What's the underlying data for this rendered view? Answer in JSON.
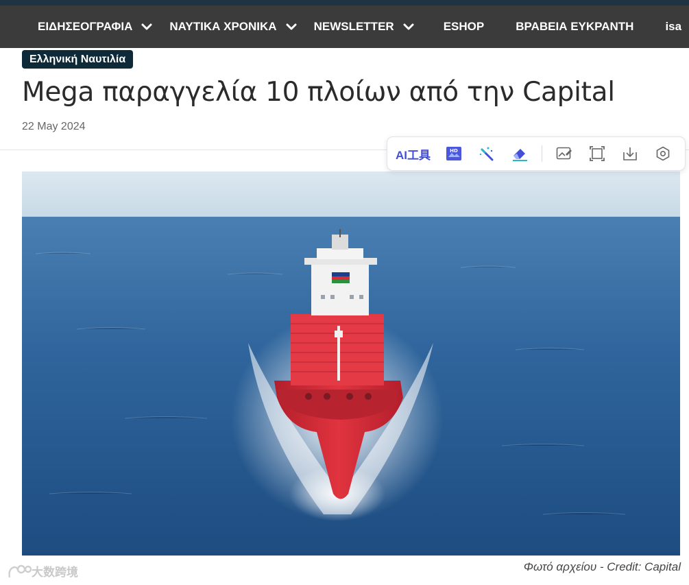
{
  "nav": {
    "items": [
      {
        "label": "ΕΙΔΗΣΕΟΓΡΑΦΙΑ",
        "has_dropdown": true,
        "icon": "chevron-down-icon"
      },
      {
        "label": "ΝΑΥΤΙΚΑ ΧΡΟΝΙΚΑ",
        "has_dropdown": true,
        "icon": "chevron-down-icon"
      },
      {
        "label": "NEWSLETTER",
        "has_dropdown": true,
        "icon": "chevron-down-icon"
      },
      {
        "label": "ESHOP",
        "has_dropdown": false
      },
      {
        "label": "ΒΡΑΒΕΙΑ ΕΥΚΡΑΝΤΗ",
        "has_dropdown": false
      },
      {
        "label": "isa",
        "has_dropdown": false
      }
    ]
  },
  "article": {
    "category": "Ελληνική Ναυτιλία",
    "title": "Mega παραγγελία 10 πλοίων από την Capital",
    "date": "22 May 2024",
    "image_caption": "Φωτό αρχείου - Credit: Capital"
  },
  "toolbar": {
    "ai_label": "AI工具",
    "buttons": [
      "hd-enhance-icon",
      "magic-wand-icon",
      "eraser-icon",
      "image-edit-icon",
      "crop-icon",
      "download-icon",
      "settings-icon"
    ]
  },
  "watermark": {
    "text": "大数跨境"
  },
  "colors": {
    "nav_bg": "#3b3b3b",
    "top_strip": "#1f3442",
    "badge_bg": "#0e2a38",
    "toolbar_accent": "#4350d6",
    "sea": "#2a5f98",
    "hull_red": "#d92e3c"
  }
}
